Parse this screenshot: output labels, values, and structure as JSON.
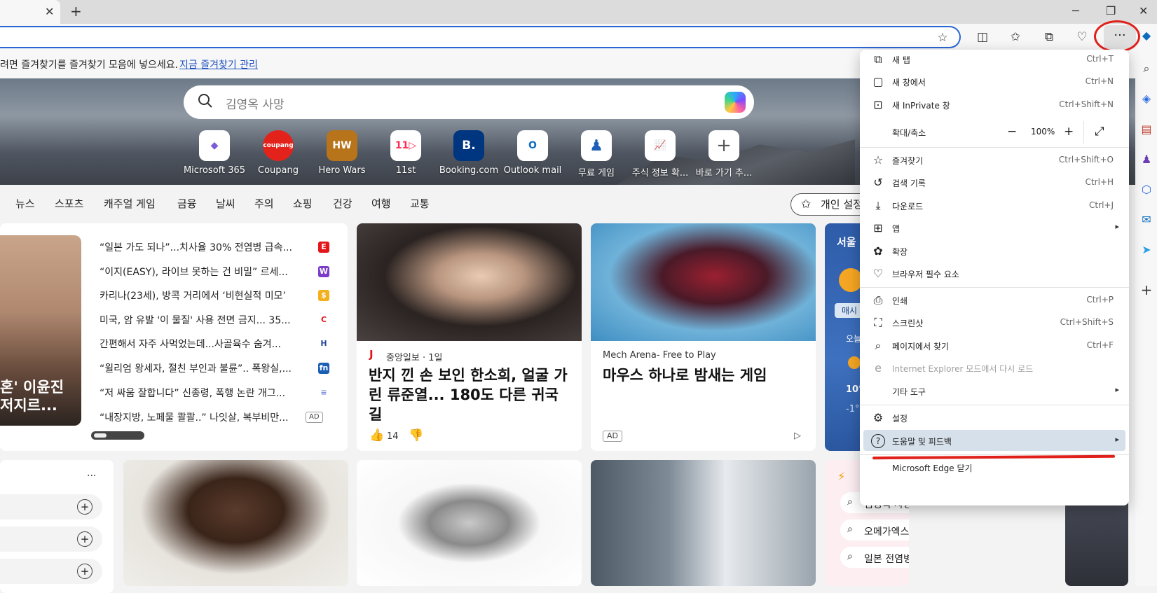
{
  "titlebar": {
    "tab_close": "✕",
    "new_tab": "+",
    "minimize": "─",
    "restore": "❐",
    "close": "✕"
  },
  "toolbar": {
    "more": "···"
  },
  "favorites_bar": {
    "text": "려면 즐겨찾기를 즐겨찾기 모음에 넣으세요.",
    "link": "지금 즐겨찾기 관리"
  },
  "search": {
    "placeholder": "김영옥 사망"
  },
  "quick_links": [
    {
      "label": "Microsoft 365",
      "tile": "◆",
      "color": "#7b5bd6"
    },
    {
      "label": "Coupang",
      "tile": "coupang",
      "color": "#e3231b"
    },
    {
      "label": "Hero Wars",
      "tile": "HW",
      "color": "#b8741a"
    },
    {
      "label": "11st",
      "tile": "11▷",
      "color": "#ff2d55"
    },
    {
      "label": "Booking.com",
      "tile": "B.",
      "color": "#003580"
    },
    {
      "label": "Outlook mail",
      "tile": "O",
      "color": "#0f6cbd"
    },
    {
      "label": "무료 게임",
      "tile": "♟",
      "color": "#1c5fb8"
    },
    {
      "label": "주식 정보 확...",
      "tile": "📈",
      "color": "#111111"
    },
    {
      "label": "바로 가기 추...",
      "tile": "+",
      "color": "#555555"
    }
  ],
  "nav": {
    "items": [
      "뉴스",
      "스포츠",
      "캐주얼 게임",
      "금융",
      "날씨",
      "주의",
      "쇼핑",
      "건강",
      "여행",
      "교통"
    ],
    "personal": "개인 설정"
  },
  "headline_card": {
    "overlay_line1": "혼' 이윤진",
    "overlay_line2": "저지르...",
    "items": [
      {
        "text": "“일본 가도 되나”...치사율 30% 전염병 급속...",
        "badge": "E",
        "badge_color": "#e3161b"
      },
      {
        "text": "“이지(EASY), 라이브 못하는 건 비밀” 르세...",
        "badge": "W",
        "badge_color": "#7a3cc9"
      },
      {
        "text": "카리나(23세), 방콕 거리에서 ‘비현실적 미모’",
        "badge": "$",
        "badge_color": "#f2b01e"
      },
      {
        "text": "미국, 암 유발 '이 물질' 사용 전면 금지... 35...",
        "badge": "C",
        "badge_color": "#e3161b"
      },
      {
        "text": "간편해서 자주 사먹었는데...사골육수 숨겨...",
        "badge": "H",
        "badge_color": "#2d4a9b"
      },
      {
        "text": "“윌리엄 왕세자, 절친 부인과 불륜”.. 폭왕실,...",
        "badge": "fn",
        "badge_color": "#1b5fb3"
      },
      {
        "text": "“저 싸움 잘합니다” 신종령, 폭행 논란 개그...",
        "badge": "≡",
        "badge_color": "#7c8bd6"
      },
      {
        "text": "“내장지방, 노페물 콸콸..” 나잇살, 복부비만...",
        "badge": "AD",
        "badge_color": "#ffffff"
      }
    ]
  },
  "article_card": {
    "source_logo": "J",
    "source": "중앙일보 · 1일",
    "title": "반지 낀 손 보인 한소희, 얼굴 가린 류준열... 180도 다른 귀국길",
    "likes": "14"
  },
  "game_card": {
    "source": "Mech Arena- Free to Play",
    "title": "마우스 하나로 밤새는 게임",
    "ad": "AD"
  },
  "weather_card": {
    "city": "서울",
    "tab": "매시",
    "today": "오늘",
    "high": "10°",
    "low": "-1°"
  },
  "left_panel": {
    "more": "···",
    "add": "+"
  },
  "trending": {
    "items": [
      "김영옥 사망",
      "오메가엑스",
      "일본 전염병"
    ]
  },
  "menu": {
    "items": [
      {
        "icon": "⧉",
        "label": "새 탭",
        "shortcut": "Ctrl+T"
      },
      {
        "icon": "▢",
        "label": "새 창에서",
        "shortcut": "Ctrl+N"
      },
      {
        "icon": "⊡",
        "label": "새 InPrivate 창",
        "shortcut": "Ctrl+Shift+N"
      },
      {
        "icon": "☆",
        "label": "즐겨찾기",
        "shortcut": "Ctrl+Shift+O"
      },
      {
        "icon": "↺",
        "label": "검색 기록",
        "shortcut": "Ctrl+H"
      },
      {
        "icon": "⤓",
        "label": "다운로드",
        "shortcut": "Ctrl+J"
      },
      {
        "icon": "⊞",
        "label": "앱",
        "shortcut": ""
      },
      {
        "icon": "✿",
        "label": "확장",
        "shortcut": ""
      },
      {
        "icon": "♡",
        "label": "브라우저 필수 요소",
        "shortcut": ""
      },
      {
        "icon": "⎙",
        "label": "인쇄",
        "shortcut": "Ctrl+P"
      },
      {
        "icon": "⛶",
        "label": "스크린샷",
        "shortcut": "Ctrl+Shift+S"
      },
      {
        "icon": "⌕",
        "label": "페이지에서 찾기",
        "shortcut": "Ctrl+F"
      },
      {
        "icon": "e",
        "label": "Internet Explorer 모드에서 다시 로드",
        "shortcut": ""
      },
      {
        "icon": "",
        "label": "기타 도구",
        "shortcut": ""
      },
      {
        "icon": "⚙",
        "label": "설정",
        "shortcut": ""
      },
      {
        "icon": "?",
        "label": "도움말 및 피드백",
        "shortcut": ""
      },
      {
        "icon": "",
        "label": "Microsoft Edge 닫기",
        "shortcut": ""
      }
    ],
    "zoom": {
      "label": "확대/축소",
      "minus": "−",
      "value": "100%",
      "plus": "+",
      "fullscreen": "⤢"
    },
    "arrow": "▸"
  }
}
